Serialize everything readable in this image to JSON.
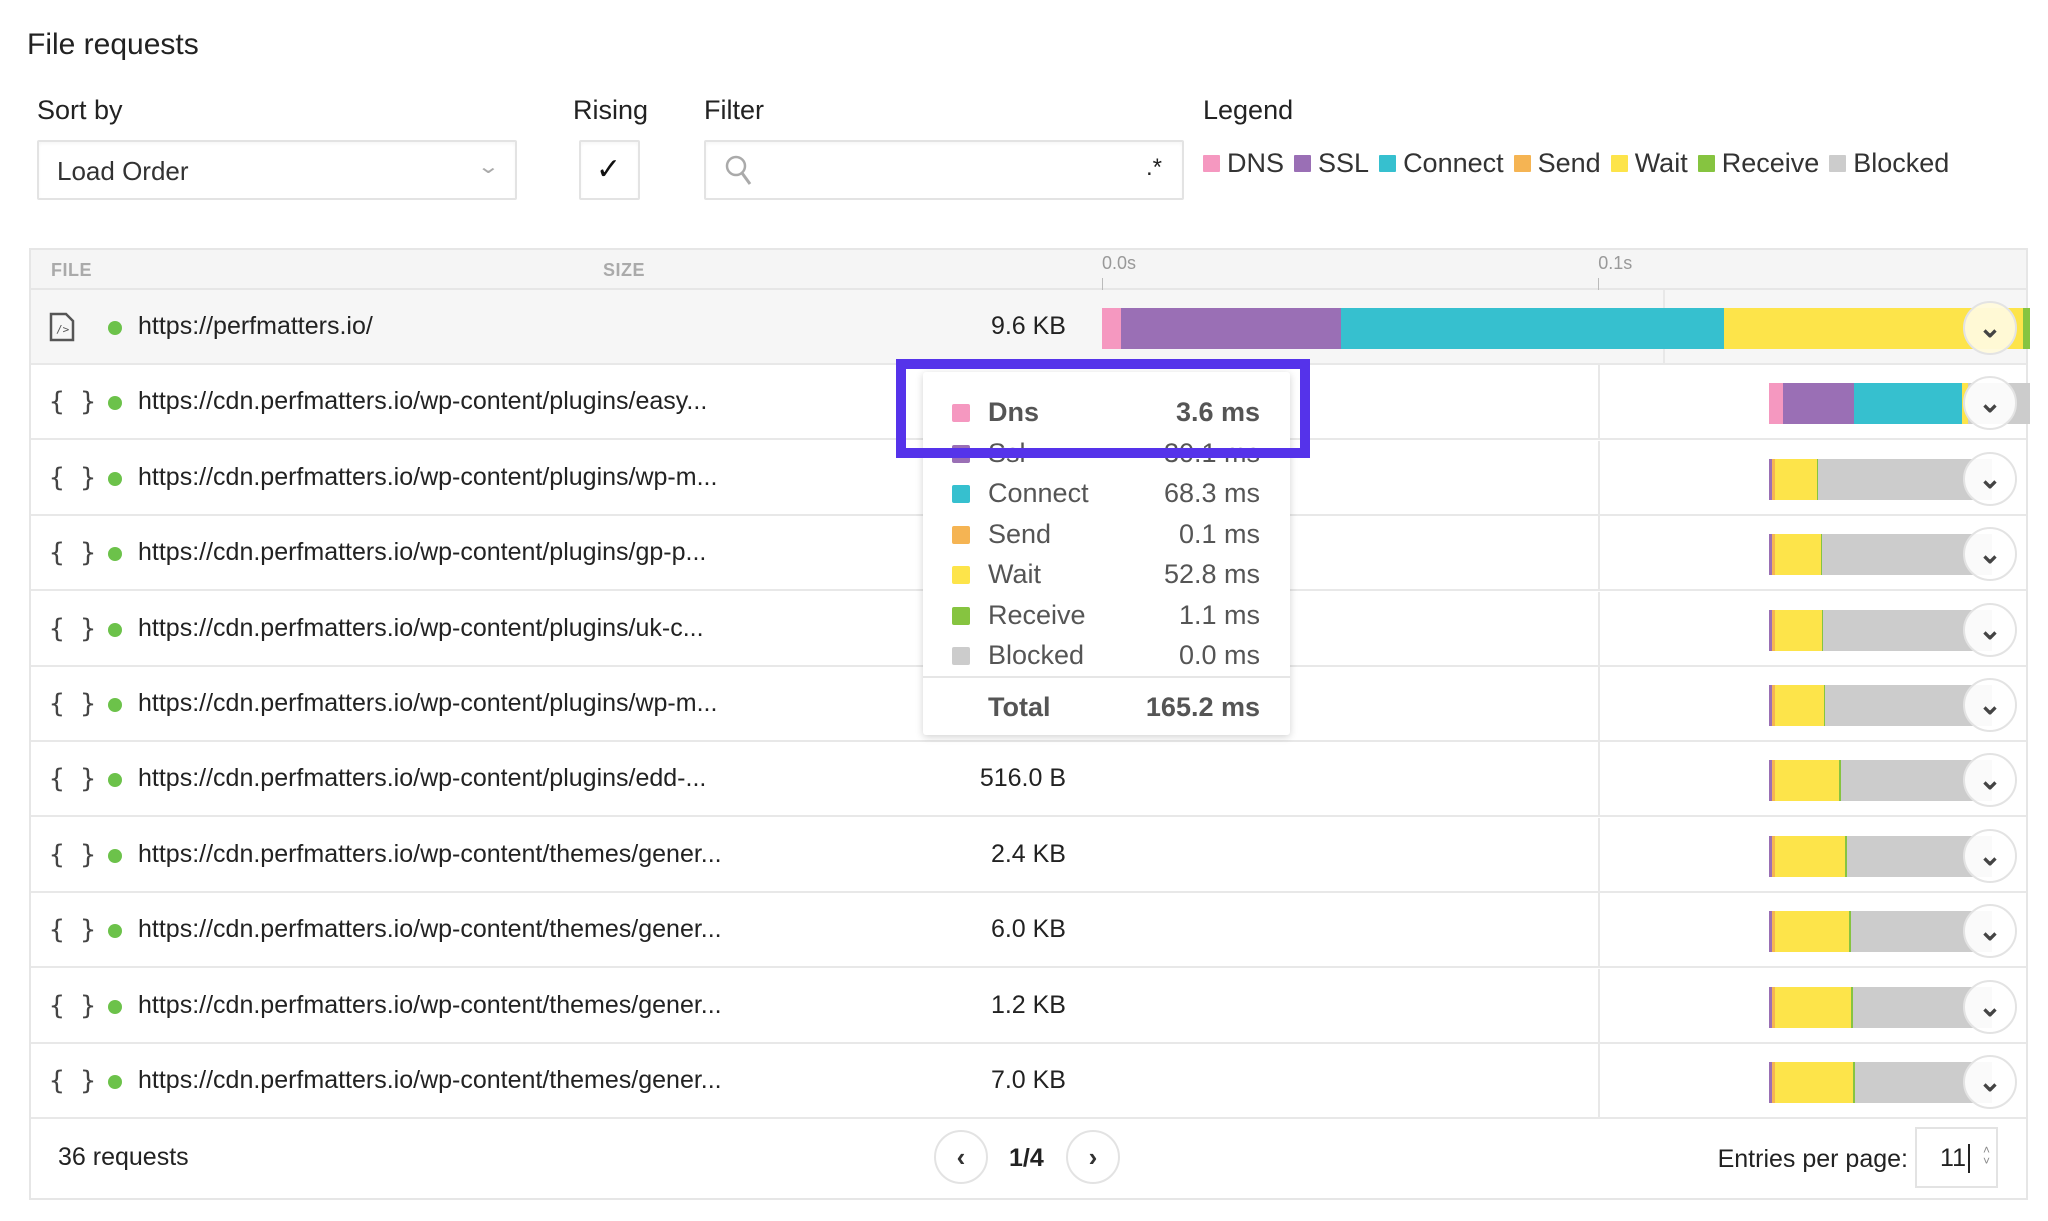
{
  "title": "File requests",
  "controls": {
    "sort_label": "Sort by",
    "sort_value": "Load Order",
    "rising_label": "Rising",
    "rising_checked": true,
    "filter_label": "Filter",
    "filter_value": "",
    "filter_regex_icon": ".*",
    "legend_label": "Legend"
  },
  "legend": [
    {
      "key": "dns",
      "label": "DNS",
      "color": "#f598c0"
    },
    {
      "key": "ssl",
      "label": "SSL",
      "color": "#9a6fb5"
    },
    {
      "key": "connect",
      "label": "Connect",
      "color": "#36c0cf"
    },
    {
      "key": "send",
      "label": "Send",
      "color": "#f5b453"
    },
    {
      "key": "wait",
      "label": "Wait",
      "color": "#fde44a"
    },
    {
      "key": "receive",
      "label": "Receive",
      "color": "#86c440"
    },
    {
      "key": "blocked",
      "label": "Blocked",
      "color": "#cccccc"
    }
  ],
  "table": {
    "headers": {
      "file": "FILE",
      "size": "SIZE"
    },
    "timeline_ticks": [
      {
        "label": "0.0s",
        "ms": 0
      },
      {
        "label": "0.1s",
        "ms": 100
      }
    ],
    "timeline_range_ms": [
      0,
      187
    ],
    "rows": [
      {
        "icon": "html-file-icon",
        "url": "https://perfmatters.io/",
        "size": "9.6 KB",
        "highlighted": true,
        "segments": [
          [
            "dns",
            0,
            3.8
          ],
          [
            "ssl",
            3.8,
            48.2
          ],
          [
            "connect",
            48.2,
            125.4
          ],
          [
            "wait",
            125.4,
            185.5
          ],
          [
            "receive",
            185.5,
            187
          ]
        ]
      },
      {
        "icon": "braces-icon",
        "url": "https://cdn.perfmatters.io/wp-content/plugins/easy...",
        "size": "",
        "segments": [
          [
            "dns",
            134.5,
            137.3
          ],
          [
            "ssl",
            137.3,
            151.6
          ],
          [
            "connect",
            151.6,
            173.2
          ],
          [
            "wait",
            173.2,
            174.6
          ],
          [
            "blocked",
            174.6,
            187
          ]
        ]
      },
      {
        "icon": "braces-icon",
        "url": "https://cdn.perfmatters.io/wp-content/plugins/wp-m...",
        "size": "",
        "segments": [
          [
            "ssl",
            134.5,
            135
          ],
          [
            "send",
            135,
            135.7
          ],
          [
            "wait",
            135.7,
            144
          ],
          [
            "receive",
            144,
            144.3
          ],
          [
            "blocked",
            144.3,
            179.4
          ]
        ]
      },
      {
        "icon": "braces-icon",
        "url": "https://cdn.perfmatters.io/wp-content/plugins/gp-p...",
        "size": "",
        "segments": [
          [
            "ssl",
            134.5,
            135
          ],
          [
            "send",
            135,
            135.7
          ],
          [
            "wait",
            135.7,
            144.8
          ],
          [
            "receive",
            144.8,
            145.1
          ],
          [
            "blocked",
            145.1,
            179.4
          ]
        ]
      },
      {
        "icon": "braces-icon",
        "url": "https://cdn.perfmatters.io/wp-content/plugins/uk-c...",
        "size": "",
        "segments": [
          [
            "ssl",
            134.5,
            135
          ],
          [
            "send",
            135,
            135.7
          ],
          [
            "wait",
            135.7,
            145
          ],
          [
            "receive",
            145,
            145.3
          ],
          [
            "blocked",
            145.3,
            179.4
          ]
        ]
      },
      {
        "icon": "braces-icon",
        "url": "https://cdn.perfmatters.io/wp-content/plugins/wp-m...",
        "size": "",
        "segments": [
          [
            "ssl",
            134.5,
            135
          ],
          [
            "send",
            135,
            135.7
          ],
          [
            "wait",
            135.7,
            145.4
          ],
          [
            "receive",
            145.4,
            145.7
          ],
          [
            "blocked",
            145.7,
            179.4
          ]
        ]
      },
      {
        "icon": "braces-icon",
        "url": "https://cdn.perfmatters.io/wp-content/plugins/edd-...",
        "size": "516.0 B",
        "segments": [
          [
            "ssl",
            134.5,
            135
          ],
          [
            "send",
            135,
            135.7
          ],
          [
            "wait",
            135.7,
            148.6
          ],
          [
            "receive",
            148.6,
            148.9
          ],
          [
            "blocked",
            148.9,
            179.4
          ]
        ]
      },
      {
        "icon": "braces-icon",
        "url": "https://cdn.perfmatters.io/wp-content/themes/gener...",
        "size": "2.4 KB",
        "segments": [
          [
            "ssl",
            134.5,
            135
          ],
          [
            "send",
            135,
            135.7
          ],
          [
            "wait",
            135.7,
            149.8
          ],
          [
            "receive",
            149.8,
            150.1
          ],
          [
            "blocked",
            150.1,
            179.4
          ]
        ]
      },
      {
        "icon": "braces-icon",
        "url": "https://cdn.perfmatters.io/wp-content/themes/gener...",
        "size": "6.0 KB",
        "segments": [
          [
            "ssl",
            134.5,
            135
          ],
          [
            "send",
            135,
            135.7
          ],
          [
            "wait",
            135.7,
            150.6
          ],
          [
            "receive",
            150.6,
            150.9
          ],
          [
            "blocked",
            150.9,
            179.4
          ]
        ]
      },
      {
        "icon": "braces-icon",
        "url": "https://cdn.perfmatters.io/wp-content/themes/gener...",
        "size": "1.2 KB",
        "segments": [
          [
            "ssl",
            134.5,
            135
          ],
          [
            "send",
            135,
            135.7
          ],
          [
            "wait",
            135.7,
            151
          ],
          [
            "receive",
            151,
            151.3
          ],
          [
            "blocked",
            151.3,
            179.4
          ]
        ]
      },
      {
        "icon": "braces-icon",
        "url": "https://cdn.perfmatters.io/wp-content/themes/gener...",
        "size": "7.0 KB",
        "segments": [
          [
            "ssl",
            134.5,
            135
          ],
          [
            "send",
            135,
            135.7
          ],
          [
            "wait",
            135.7,
            151.4
          ],
          [
            "receive",
            151.4,
            151.7
          ],
          [
            "blocked",
            151.7,
            179.4
          ]
        ]
      }
    ]
  },
  "footer": {
    "request_count": "36 requests",
    "page": "1/4",
    "entries_label": "Entries per page:",
    "entries_value": "11"
  },
  "tooltip": {
    "rows": [
      {
        "key": "dns",
        "label": "Dns",
        "value": "3.6 ms",
        "bold": true
      },
      {
        "key": "ssl",
        "label": "Ssl",
        "value": "30.1 ms"
      },
      {
        "key": "connect",
        "label": "Connect",
        "value": "68.3 ms"
      },
      {
        "key": "send",
        "label": "Send",
        "value": "0.1 ms"
      },
      {
        "key": "wait",
        "label": "Wait",
        "value": "52.8 ms"
      },
      {
        "key": "receive",
        "label": "Receive",
        "value": "1.1 ms"
      },
      {
        "key": "blocked",
        "label": "Blocked",
        "value": "0.0 ms"
      }
    ],
    "total_label": "Total",
    "total_value": "165.2 ms"
  },
  "highlight_color": "#5533ea"
}
